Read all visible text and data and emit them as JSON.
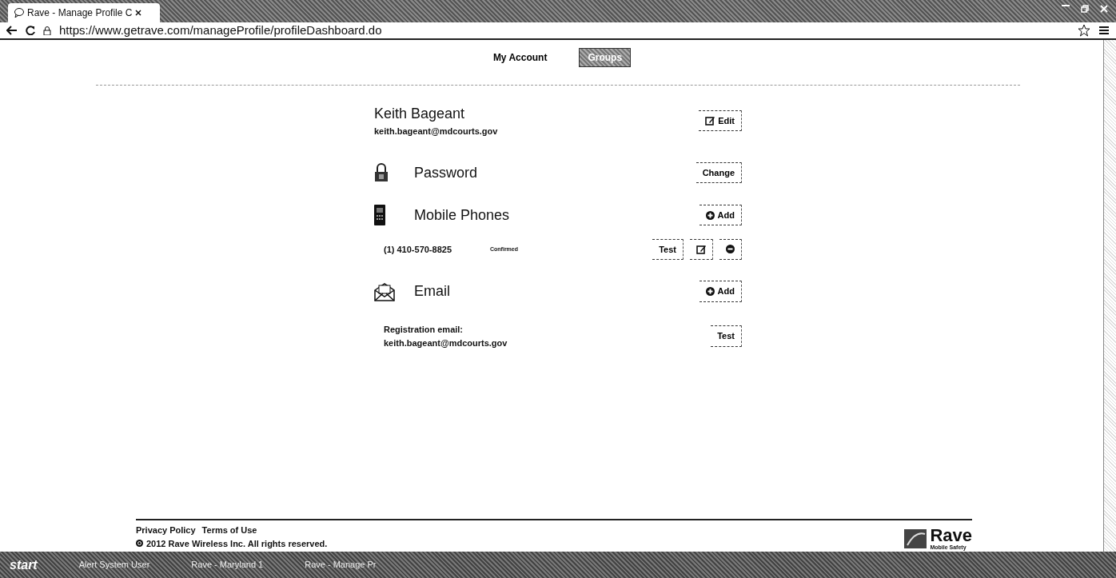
{
  "browser": {
    "tab_title": "Rave - Manage Profile C",
    "url": "https://www.getrave.com/manageProfile/profileDashboard.do"
  },
  "nav_tabs": [
    {
      "label": "My Account",
      "selected": false
    },
    {
      "label": "Groups",
      "selected": true
    }
  ],
  "profile": {
    "name": "Keith Bageant",
    "email": "keith.bageant@mdcourts.gov",
    "button": {
      "kind": "edit",
      "label": "Edit"
    }
  },
  "sections": [
    {
      "kind": "password",
      "title": "Password",
      "button": {
        "kind": "text",
        "label": "Change"
      }
    },
    {
      "kind": "phone",
      "title": "Mobile Phones",
      "button": {
        "kind": "add",
        "label": "Add"
      },
      "items": [
        {
          "text": "(1) 410-570-8825",
          "status": "Confirmed",
          "buttons": [
            {
              "kind": "text",
              "label": "Test"
            },
            {
              "kind": "edit-only"
            },
            {
              "kind": "remove"
            }
          ]
        }
      ]
    },
    {
      "kind": "email",
      "title": "Email",
      "button": {
        "kind": "add",
        "label": "Add"
      },
      "items": [
        {
          "label": "Registration email:",
          "text": "keith.bageant@mdcourts.gov",
          "buttons": [
            {
              "kind": "text",
              "label": "Test"
            }
          ]
        }
      ]
    }
  ],
  "footer": {
    "links": [
      "Privacy Policy",
      "Terms of Use"
    ],
    "copyright": "2012 Rave Wireless Inc. All rights reserved.",
    "logo_name": "Rave",
    "logo_tagline": "Mobile Safety"
  },
  "taskbar": {
    "start": "start",
    "windows": [
      "Alert System User",
      "Rave - Maryland 1",
      "Rave - Manage Pr"
    ]
  }
}
